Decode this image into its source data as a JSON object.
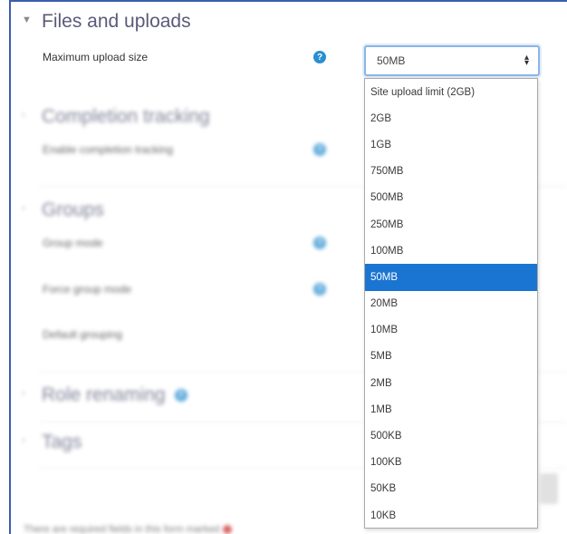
{
  "sections": {
    "files": {
      "title": "Files and uploads",
      "max_upload_label": "Maximum upload size"
    },
    "completion": {
      "title": "Completion tracking",
      "enable_label": "Enable completion tracking"
    },
    "groups": {
      "title": "Groups",
      "group_mode_label": "Group mode",
      "force_group_mode_label": "Force group mode",
      "default_grouping_label": "Default grouping"
    },
    "roles": {
      "title": "Role renaming"
    },
    "tags": {
      "title": "Tags"
    }
  },
  "upload_select": {
    "value": "50MB",
    "options": [
      "Site upload limit (2GB)",
      "2GB",
      "1GB",
      "750MB",
      "500MB",
      "250MB",
      "100MB",
      "50MB",
      "20MB",
      "10MB",
      "5MB",
      "2MB",
      "1MB",
      "500KB",
      "100KB",
      "50KB",
      "10KB"
    ],
    "selected_index": 7
  },
  "footer": {
    "required_note": "There are required fields in this form marked"
  },
  "icons": {
    "help": "help-question-icon",
    "chevron": "chevron-down-icon",
    "required": "required-marker-icon"
  },
  "colors": {
    "accent": "#1a75d2",
    "help": "#2a8fd0",
    "frame": "#3b5fae"
  }
}
